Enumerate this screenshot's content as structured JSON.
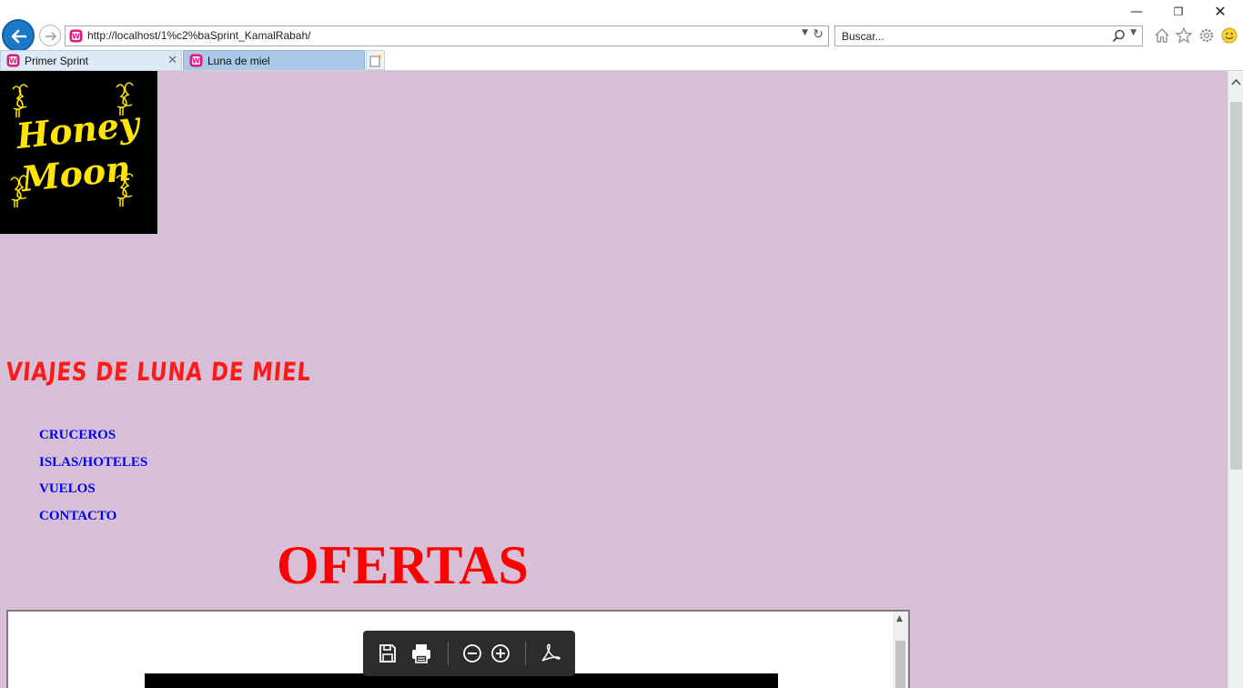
{
  "window": {
    "minimize_glyph": "—",
    "restore_glyph": "❐",
    "close_glyph": "✕"
  },
  "address_bar": {
    "url": "http://localhost/1%c2%baSprint_KamalRabah/",
    "favicon": "wampserver-icon"
  },
  "search_bar": {
    "placeholder": "Buscar..."
  },
  "toolbar_icons": [
    "home-icon",
    "star-icon",
    "gear-icon",
    "smiley-icon"
  ],
  "tabs": [
    {
      "label": "Primer Sprint",
      "active": true,
      "close_glyph": "✕"
    },
    {
      "label": "Luna de miel",
      "active": false
    }
  ],
  "page": {
    "background": "#d8bfd8",
    "logo": {
      "line1": "Honey",
      "line2": "Moon",
      "color": "#ffe600"
    },
    "site_title": "VIAJES DE LUNA DE MIEL",
    "title_color": "#ff1a1a",
    "nav": [
      {
        "label": "CRUCEROS"
      },
      {
        "label": "ISLAS/HOTELES"
      },
      {
        "label": "VUELOS"
      },
      {
        "label": "CONTACTO"
      }
    ],
    "nav_color": "#0000ee",
    "offers_heading": "OFERTAS",
    "offers_color": "#ff0000",
    "pdf_viewer": {
      "toolbar": [
        "save-icon",
        "print-icon",
        "zoom-out-icon",
        "zoom-in-icon",
        "acrobat-icon"
      ]
    }
  }
}
